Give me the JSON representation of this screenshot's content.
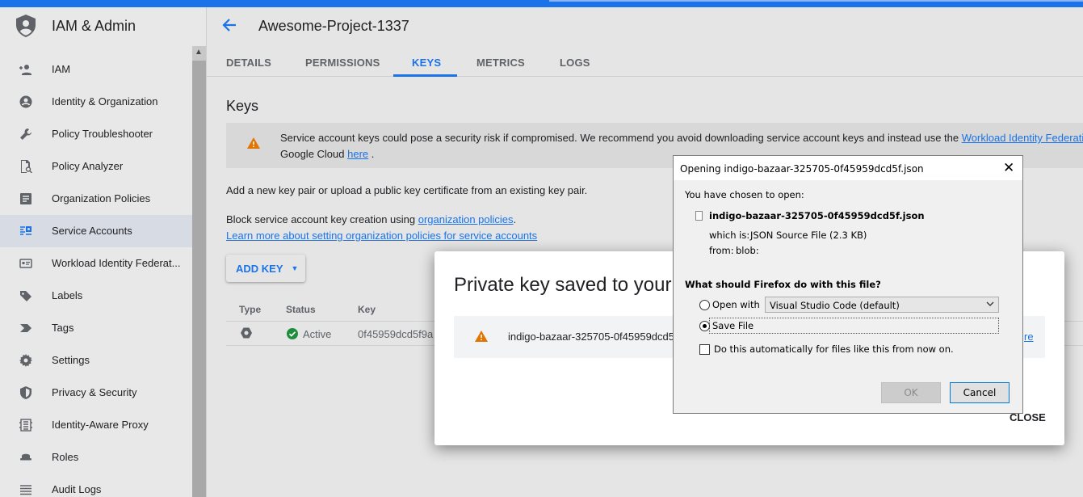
{
  "sidebar": {
    "title": "IAM & Admin",
    "items": [
      {
        "label": "IAM",
        "icon": "person-add-icon"
      },
      {
        "label": "Identity & Organization",
        "icon": "account-circle-icon"
      },
      {
        "label": "Policy Troubleshooter",
        "icon": "wrench-icon"
      },
      {
        "label": "Policy Analyzer",
        "icon": "document-search-icon"
      },
      {
        "label": "Organization Policies",
        "icon": "list-doc-icon"
      },
      {
        "label": "Service Accounts",
        "icon": "service-account-icon"
      },
      {
        "label": "Workload Identity Federat...",
        "icon": "id-card-icon"
      },
      {
        "label": "Labels",
        "icon": "label-icon"
      },
      {
        "label": "Tags",
        "icon": "tag-chevron-icon"
      },
      {
        "label": "Settings",
        "icon": "gear-icon"
      },
      {
        "label": "Privacy & Security",
        "icon": "shield-icon"
      },
      {
        "label": "Identity-Aware Proxy",
        "icon": "proxy-icon"
      },
      {
        "label": "Roles",
        "icon": "roles-hat-icon"
      },
      {
        "label": "Audit Logs",
        "icon": "list-lines-icon"
      }
    ]
  },
  "header": {
    "title": "Awesome-Project-1337"
  },
  "tabs": [
    "DETAILS",
    "PERMISSIONS",
    "KEYS",
    "METRICS",
    "LOGS"
  ],
  "keys": {
    "heading": "Keys",
    "warning_line1": "Service account keys could pose a security risk if compromised. We recommend you avoid downloading service account keys and instead use the ",
    "warning_link1": "Workload Identity Federatio",
    "warning_line2": "Google Cloud ",
    "warning_link2": "here",
    "warning_end": " .",
    "add_pair_text": "Add a new key pair or upload a public key certificate from an existing key pair.",
    "block_text": "Block service account key creation using ",
    "block_link": "organization policies",
    "block_end": ".",
    "learn_link": "Learn more about setting organization policies for service accounts",
    "add_key_label": "ADD KEY",
    "table": {
      "headers": [
        "Type",
        "Status",
        "Key"
      ],
      "rows": [
        {
          "status": "Active",
          "key": "0f45959dcd5f9a"
        }
      ]
    }
  },
  "private_key_dialog": {
    "title": "Private key saved to your c",
    "file_name": "indigo-bazaar-325705-0f45959dcd5",
    "more_link": "re",
    "close_label": "CLOSE"
  },
  "firefox_dialog": {
    "title": "Opening indigo-bazaar-325705-0f45959dcd5f.json",
    "chosen_text": "You have chosen to open:",
    "file_name": "indigo-bazaar-325705-0f45959dcd5f.json",
    "which_is_label": "which is:",
    "which_is_value": "JSON Source File (2.3 KB)",
    "from_label": "from:",
    "from_value": "blob:",
    "question": "What should Firefox do with this file?",
    "open_with_label": "Open with",
    "open_with_value": "Visual Studio Code (default)",
    "save_file_label": "Save File",
    "auto_label": "Do this automatically for files like this from now on.",
    "selected_option": "save_file",
    "ok_label": "OK",
    "cancel_label": "Cancel"
  },
  "colors": {
    "accent": "#1a73e8",
    "warning": "#e37400",
    "active_green": "#1e8e3e"
  }
}
